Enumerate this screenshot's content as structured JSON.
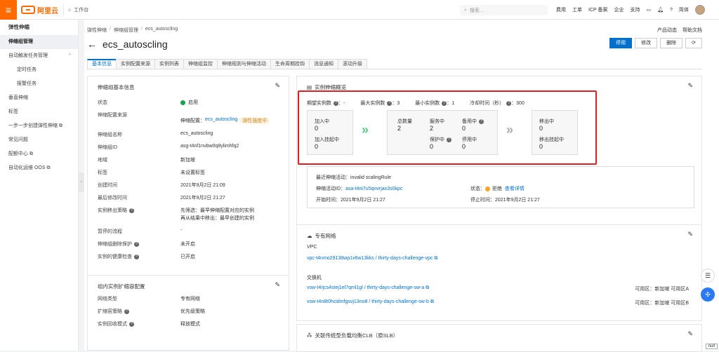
{
  "topbar": {
    "logo_text": "阿里云",
    "workbench": "工作台",
    "search_placeholder": "搜索...",
    "nav": [
      "费用",
      "工单",
      "ICP 备案",
      "企业",
      "支持"
    ],
    "lang": "简体",
    "accent_color": "#ff6a00"
  },
  "sidebar": {
    "title": "弹性伸缩",
    "items": [
      {
        "label": "伸缩组管理",
        "active": true
      },
      {
        "label": "自动触发任务管理",
        "chevron": "^"
      },
      {
        "label": "定时任务",
        "sub": true
      },
      {
        "label": "报警任务",
        "sub": true
      },
      {
        "label": "垂直伸缩"
      },
      {
        "label": "标签"
      },
      {
        "label": "一步一步创建弹性伸缩 ⧉"
      },
      {
        "label": "常见问题"
      },
      {
        "label": "配额中心 ⧉"
      },
      {
        "label": "自动化运维 OOS ⧉"
      }
    ]
  },
  "breadcrumb": {
    "items": [
      "弹性伸缩",
      "伸缩组管理",
      "ecs_autoscling"
    ]
  },
  "page_title": "ecs_autoscling",
  "toplinks": {
    "product": "产品动态",
    "help": "帮助文档"
  },
  "actions": {
    "disable": "停用",
    "modify": "修改",
    "delete": "删除",
    "refresh": "⟳"
  },
  "tabs": [
    "基本信息",
    "实例配置来源",
    "实例列表",
    "伸缩组监控",
    "伸缩规则与伸缩活动",
    "生命周期挂钩",
    "消息通知",
    "滚动升级"
  ],
  "basic_card": {
    "title": "伸缩组基本信息",
    "rows": [
      {
        "k": "状态",
        "v": "启用"
      },
      {
        "k": "伸缩配置来源",
        "v": "伸缩配置：",
        "link": "ecs_autoscling",
        "tag": "弹性强度中"
      },
      {
        "k": "伸缩组名称",
        "v": "ecs_autoscling"
      },
      {
        "k": "伸缩组ID",
        "v": "asg-t4nf1nvbw0q8ylimhfq2"
      },
      {
        "k": "地域",
        "v": "新加坡"
      },
      {
        "k": "标签",
        "v": "未设置标签"
      },
      {
        "k": "创建时间",
        "v": "2021年9月2日 21:09"
      },
      {
        "k": "最后修改时间",
        "v": "2021年9月2日 21:27"
      },
      {
        "k": "实例移出策略",
        "v": "先筛选：最早伸缩配置对应的实例",
        "v2": "再从结果中移出：最早创建的实例"
      },
      {
        "k": "暂停的流程",
        "v": "-"
      },
      {
        "k": "伸缩组删除保护",
        "v": "未开启"
      },
      {
        "k": "实例的健康检查",
        "v": "已开启"
      }
    ]
  },
  "scale_card": {
    "title": "组内实例扩缩容配置",
    "rows": [
      {
        "k": "网络类型",
        "v": "专有网络"
      },
      {
        "k": "扩缩容策略",
        "v": "优先级策略"
      },
      {
        "k": "实例回收模式",
        "v": "释放模式"
      }
    ]
  },
  "overview": {
    "title": "实例伸缩概览",
    "expected_label": "期望实例数",
    "expected": "-",
    "max_label": "最大实例数",
    "max": "3",
    "min_label": "最小实例数",
    "min": "1",
    "cooldown_label": "冷却时间（秒）",
    "cooldown": "300",
    "joining_label": "加入中",
    "joining": "0",
    "join_pending_label": "加入挂起中",
    "join_pending": "0",
    "total_label": "总数量",
    "total": "2",
    "inservice_label": "服务中",
    "inservice": "2",
    "standby_label": "备用中",
    "standby": "0",
    "protected_label": "保护中",
    "protected": "0",
    "stopped_label": "停用中",
    "stopped": "0",
    "removing_label": "移出中",
    "removing": "0",
    "remove_pending_label": "移出挂起中",
    "remove_pending": "0"
  },
  "activity": {
    "recent": "最近伸缩活动：invalid scalingRule",
    "id_label": "伸缩活动ID：",
    "id": "asa-t4ni7u5qnvrjax3s0kpc",
    "status_label": "状态：",
    "status": "拒绝",
    "detail": "查看详情",
    "start": "开始时间：2021年9月2日 21:27",
    "stop": "停止时间：2021年9月2日 21:27"
  },
  "vpc_card": {
    "title": "专有网络",
    "vpc_label": "VPC",
    "vpc": "vpc-t4nmo29138wp1x6w13kks / thirty-days-challenge-vpc",
    "vsw_label": "交换机",
    "vsw1": "vsw-t4rjcs4stej1el7qml1gl / thirty-days-challenge-sw-a",
    "zone1": "可用区：新加坡 可用区A",
    "vsw2": "vsw-t4n8t0hcidmfgsvj13no8 / thirty-days-challenge-sw-b",
    "zone2": "可用区：新加坡 可用区B"
  },
  "slb_card": {
    "title": "关联传统型负载均衡CLB（原SLB）"
  },
  "null_tag": "null"
}
